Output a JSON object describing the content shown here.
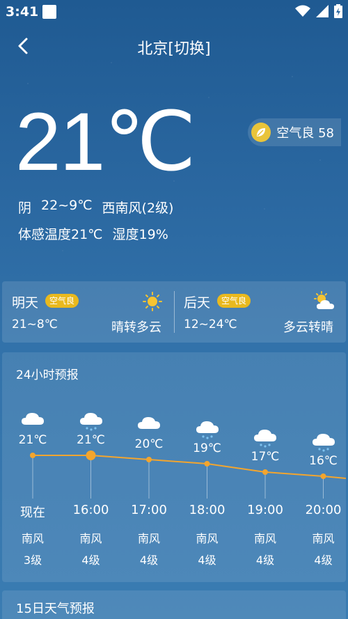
{
  "status_bar": {
    "time": "3:41"
  },
  "header": {
    "title": "北京[切换]"
  },
  "current": {
    "temperature": "21℃",
    "aqi_label": "空气良 58",
    "condition": "阴",
    "range": "22~9℃",
    "wind": "西南风(2级)",
    "feels_like": "体感温度21℃",
    "humidity": "湿度19%"
  },
  "two_day": [
    {
      "name": "明天",
      "aqi": "空气良",
      "range": "21~8℃",
      "condition": "晴转多云",
      "icon": "sun-icon"
    },
    {
      "name": "后天",
      "aqi": "空气良",
      "range": "12~24℃",
      "condition": "多云转晴",
      "icon": "partly-cloudy-icon"
    }
  ],
  "hourly": {
    "title": "24小时预报",
    "items": [
      {
        "time": "现在",
        "temp": "21℃",
        "temp_value": 21,
        "icon": "cloud-icon",
        "wind_dir": "南风",
        "wind_level": "3级"
      },
      {
        "time": "16:00",
        "temp": "21℃",
        "temp_value": 21,
        "icon": "rain-cloud-icon",
        "wind_dir": "南风",
        "wind_level": "4级"
      },
      {
        "time": "17:00",
        "temp": "20℃",
        "temp_value": 20,
        "icon": "cloud-icon",
        "wind_dir": "南风",
        "wind_level": "4级"
      },
      {
        "time": "18:00",
        "temp": "19℃",
        "temp_value": 19,
        "icon": "rain-cloud-icon",
        "wind_dir": "南风",
        "wind_level": "4级"
      },
      {
        "time": "19:00",
        "temp": "17℃",
        "temp_value": 17,
        "icon": "rain-cloud-icon",
        "wind_dir": "南风",
        "wind_level": "4级"
      },
      {
        "time": "20:00",
        "temp": "16℃",
        "temp_value": 16,
        "icon": "rain-cloud-icon",
        "wind_dir": "南风",
        "wind_level": "4级"
      }
    ]
  },
  "fifteen_day": {
    "title": "15日天气预报"
  },
  "colors": {
    "line": "#f3a52e",
    "badge": "#e9b91e",
    "leaf_bg": "#e9c43a"
  }
}
